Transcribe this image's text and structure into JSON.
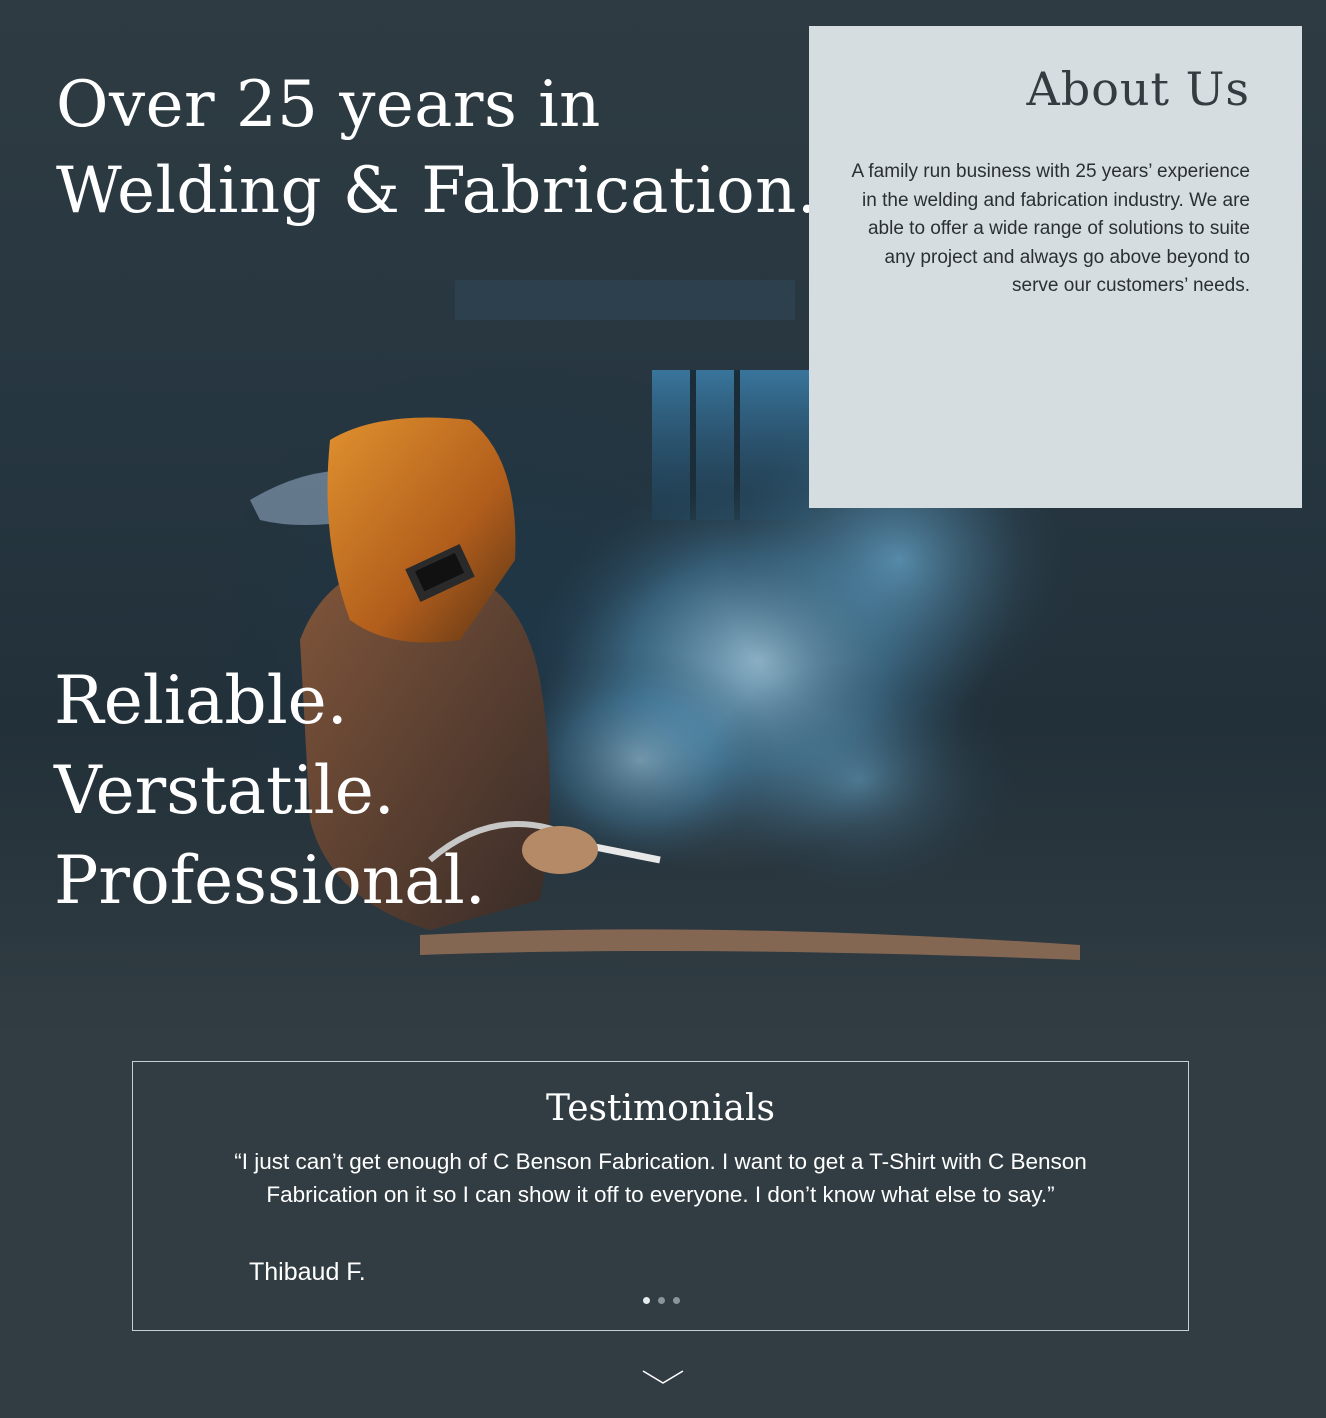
{
  "hero": {
    "headline_line1": "Over 25 years in",
    "headline_line2": "Welding & Fabrication.",
    "tagline_line1": "Reliable.",
    "tagline_line2": "Verstatile.",
    "tagline_line3": "Professional.",
    "image_subject": "welder in protective mask with smoke"
  },
  "about": {
    "title": "About Us",
    "body": "A family run business with 25 years’ experience in the welding and fabrication industry. We are able to offer a wide range of solutions to suite any project and always go above beyond to serve our customers’ needs."
  },
  "testimonials": {
    "title": "Testimonials",
    "quote": "“I just can’t get enough of C Benson Fabrication. I want to get a T-Shirt with C Benson Fabrication on it so I can show it off to everyone. I don’t know what else to say.”",
    "author": "Thibaud F.",
    "slide_count": 3,
    "active_slide": 1
  },
  "icons": {
    "scroll_down": "chevron-down-icon"
  },
  "colors": {
    "page_background": "#323d43",
    "about_panel": "#d5dde0",
    "text_light": "#ffffff",
    "text_dark": "#333c41"
  }
}
